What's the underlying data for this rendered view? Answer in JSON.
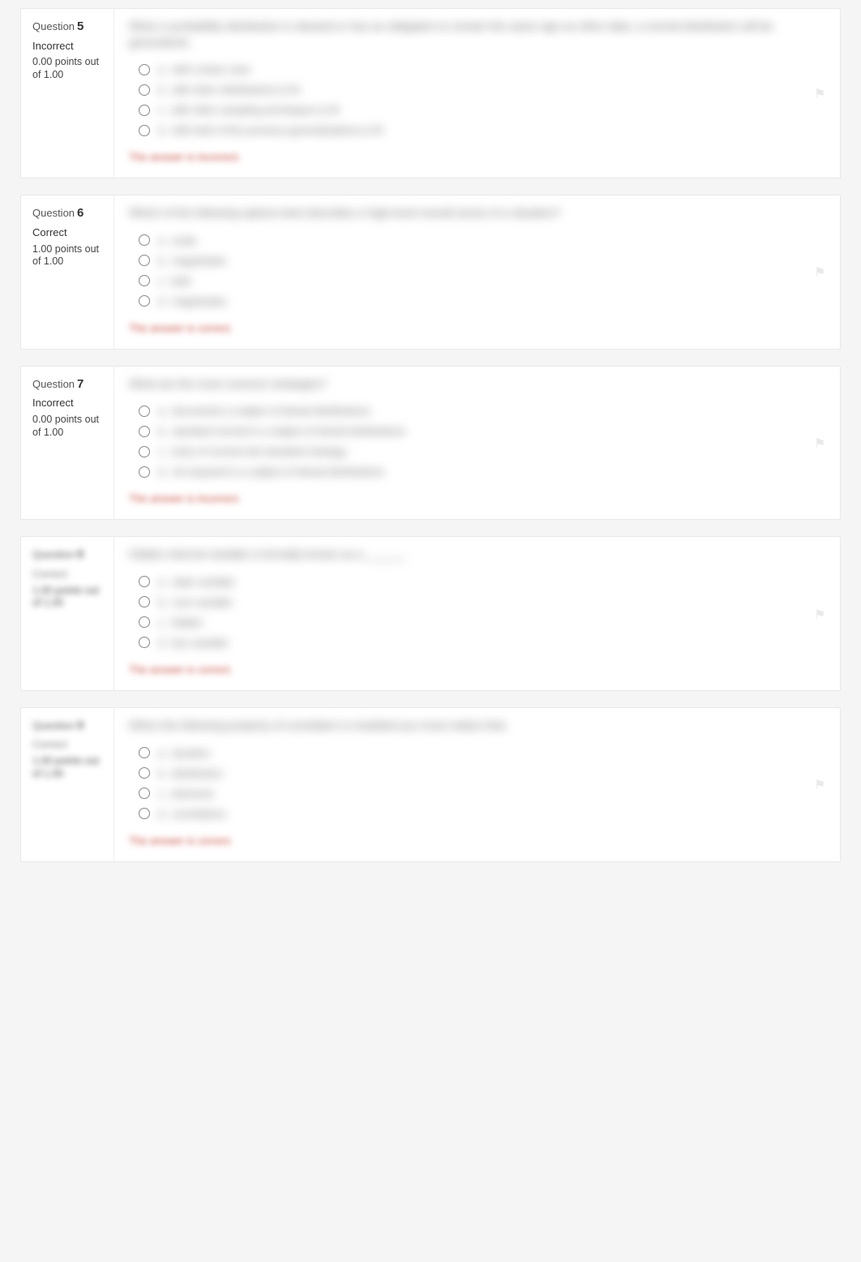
{
  "labels": {
    "question": "Question",
    "flag_title": "Flag question"
  },
  "feedback": {
    "incorrect": "The answer is incorrect.",
    "correct": "The answer is correct."
  },
  "questions": [
    {
      "number": "5",
      "status": "Incorrect",
      "points": "0.00 points out of 1.00",
      "clear_meta": true,
      "prompt": "When a probability distribution is skewed or has an obligation to remain the same sign as other data, a normal distribution will be generalized.",
      "choices": [
        {
          "letter": "a.",
          "text": "with a base case"
        },
        {
          "letter": "b.",
          "text": "with other distributions to fit"
        },
        {
          "letter": "c.",
          "text": "with other sampling techniques to fit"
        },
        {
          "letter": "d.",
          "text": "with both of the previous generalizations to fit"
        }
      ],
      "feedback": "incorrect"
    },
    {
      "number": "6",
      "status": "Correct",
      "points": "1.00 points out of 1.00",
      "clear_meta": true,
      "prompt": "Which of the following options best describes a high-level overall sense of a situation?",
      "choices": [
        {
          "letter": "a.",
          "text": "scale"
        },
        {
          "letter": "b.",
          "text": "magnitudes"
        },
        {
          "letter": "c.",
          "text": "bulk"
        },
        {
          "letter": "d.",
          "text": "magnitudes"
        }
      ],
      "feedback": "correct"
    },
    {
      "number": "7",
      "status": "Incorrect",
      "points": "0.00 points out of 1.00",
      "clear_meta": true,
      "points_clear": true,
      "prompt": "What are the most common strategies?",
      "choices": [
        {
          "letter": "a.",
          "text": "documents a subject of denial distributions"
        },
        {
          "letter": "b.",
          "text": "standard normal is a subject of denial distributions"
        },
        {
          "letter": "c.",
          "text": "entry of normal and standard strategy"
        },
        {
          "letter": "d.",
          "text": "chi-squared is a subject of denial distributions"
        }
      ],
      "feedback": "incorrect"
    },
    {
      "number": "8",
      "status": "Correct",
      "points": "1.00 points out of 1.00",
      "clear_meta": false,
      "prompt": "Hidden internal variable is formally known as a ______.",
      "choices": [
        {
          "letter": "a.",
          "text": "state variable"
        },
        {
          "letter": "b.",
          "text": "core variable"
        },
        {
          "letter": "c.",
          "text": "hidden"
        },
        {
          "letter": "d.",
          "text": "key variable"
        }
      ],
      "feedback": "correct"
    },
    {
      "number": "9",
      "status": "Correct",
      "points": "1.00 points out of 1.00",
      "clear_meta": false,
      "prompt": "When the following property of correlation is modeled you must realize that:",
      "choices": [
        {
          "letter": "a.",
          "text": "duration"
        },
        {
          "letter": "b.",
          "text": "distribution"
        },
        {
          "letter": "c.",
          "text": "elements"
        },
        {
          "letter": "d.",
          "text": "correlations"
        }
      ],
      "feedback": "correct"
    }
  ]
}
